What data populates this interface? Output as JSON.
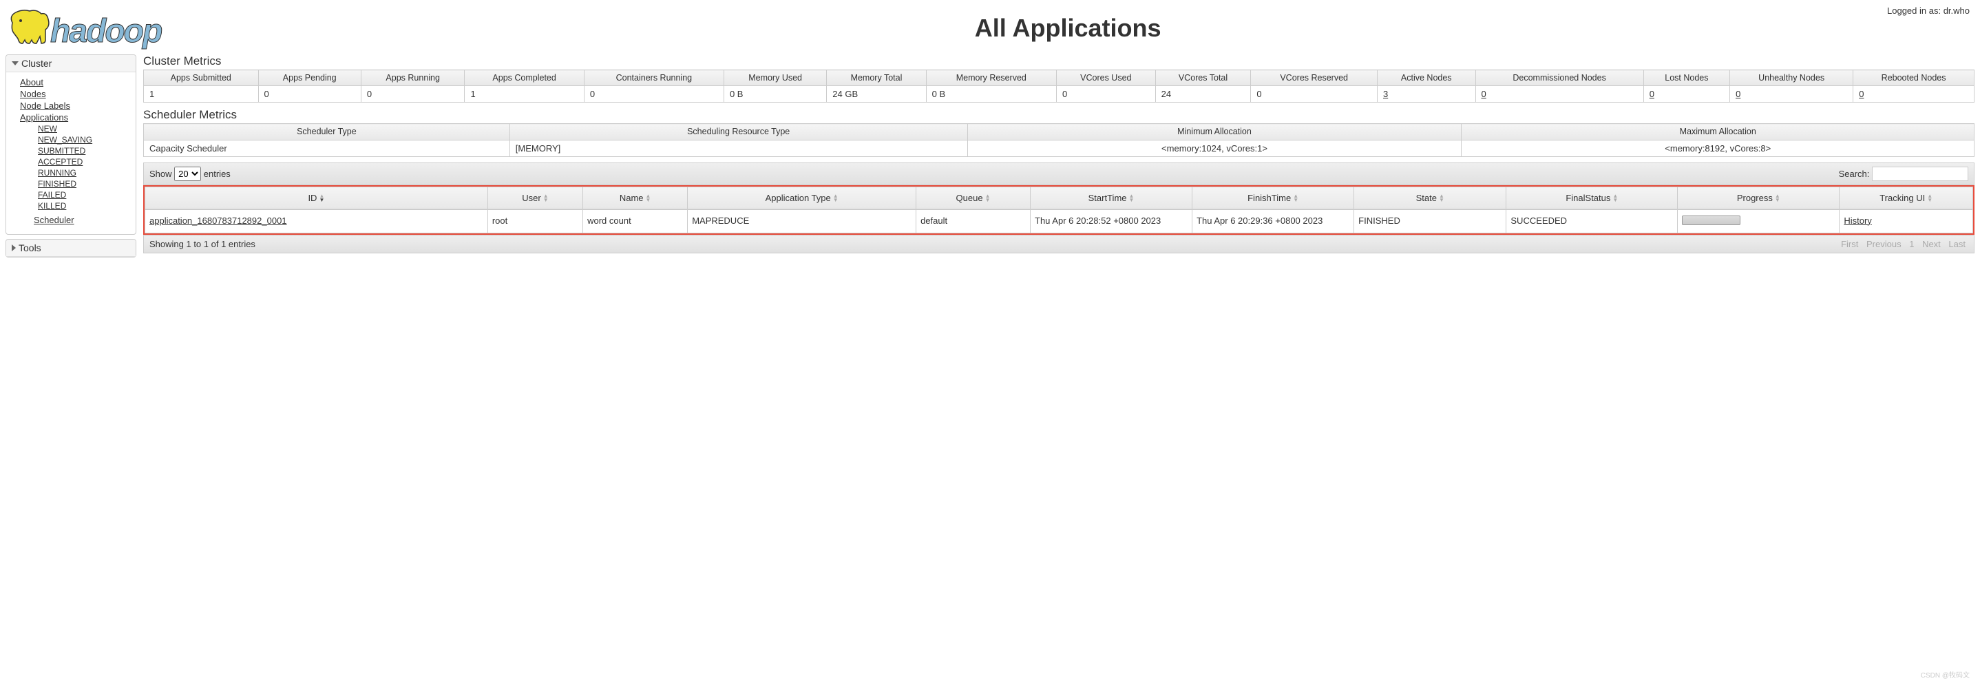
{
  "login_text": "Logged in as: dr.who",
  "logo_text": "hadoop",
  "page_title": "All Applications",
  "sidebar": {
    "cluster_header": "Cluster",
    "links": {
      "about": "About",
      "nodes": "Nodes",
      "node_labels": "Node Labels",
      "applications": "Applications",
      "scheduler": "Scheduler"
    },
    "app_states": {
      "new": "NEW",
      "new_saving": "NEW_SAVING",
      "submitted": "SUBMITTED",
      "accepted": "ACCEPTED",
      "running": "RUNNING",
      "finished": "FINISHED",
      "failed": "FAILED",
      "killed": "KILLED"
    },
    "tools_header": "Tools"
  },
  "cluster_metrics": {
    "title": "Cluster Metrics",
    "headers": {
      "apps_submitted": "Apps Submitted",
      "apps_pending": "Apps Pending",
      "apps_running": "Apps Running",
      "apps_completed": "Apps Completed",
      "containers_running": "Containers Running",
      "memory_used": "Memory Used",
      "memory_total": "Memory Total",
      "memory_reserved": "Memory Reserved",
      "vcores_used": "VCores Used",
      "vcores_total": "VCores Total",
      "vcores_reserved": "VCores Reserved",
      "active_nodes": "Active Nodes",
      "decommissioned_nodes": "Decommissioned Nodes",
      "lost_nodes": "Lost Nodes",
      "unhealthy_nodes": "Unhealthy Nodes",
      "rebooted_nodes": "Rebooted Nodes"
    },
    "values": {
      "apps_submitted": "1",
      "apps_pending": "0",
      "apps_running": "0",
      "apps_completed": "1",
      "containers_running": "0",
      "memory_used": "0 B",
      "memory_total": "24 GB",
      "memory_reserved": "0 B",
      "vcores_used": "0",
      "vcores_total": "24",
      "vcores_reserved": "0",
      "active_nodes": "3",
      "decommissioned_nodes": "0",
      "lost_nodes": "0",
      "unhealthy_nodes": "0",
      "rebooted_nodes": "0"
    }
  },
  "scheduler_metrics": {
    "title": "Scheduler Metrics",
    "headers": {
      "type": "Scheduler Type",
      "resource_type": "Scheduling Resource Type",
      "min_alloc": "Minimum Allocation",
      "max_alloc": "Maximum Allocation"
    },
    "values": {
      "type": "Capacity Scheduler",
      "resource_type": "[MEMORY]",
      "min_alloc": "<memory:1024, vCores:1>",
      "max_alloc": "<memory:8192, vCores:8>"
    }
  },
  "controls": {
    "show": "Show",
    "entries": "entries",
    "page_size": "20",
    "search_label": "Search:"
  },
  "apps": {
    "headers": {
      "id": "ID",
      "user": "User",
      "name": "Name",
      "app_type": "Application Type",
      "queue": "Queue",
      "start": "StartTime",
      "finish": "FinishTime",
      "state": "State",
      "final": "FinalStatus",
      "progress": "Progress",
      "tracking": "Tracking UI"
    },
    "row": {
      "id": "application_1680783712892_0001",
      "user": "root",
      "name": "word count",
      "app_type": "MAPREDUCE",
      "queue": "default",
      "start": "Thu Apr 6 20:28:52 +0800 2023",
      "finish": "Thu Apr 6 20:29:36 +0800 2023",
      "state": "FINISHED",
      "final": "SUCCEEDED",
      "tracking": "History"
    }
  },
  "footer": {
    "info": "Showing 1 to 1 of 1 entries",
    "first": "First",
    "previous": "Previous",
    "page": "1",
    "next": "Next",
    "last": "Last"
  },
  "watermark": "CSDN @牧码文"
}
